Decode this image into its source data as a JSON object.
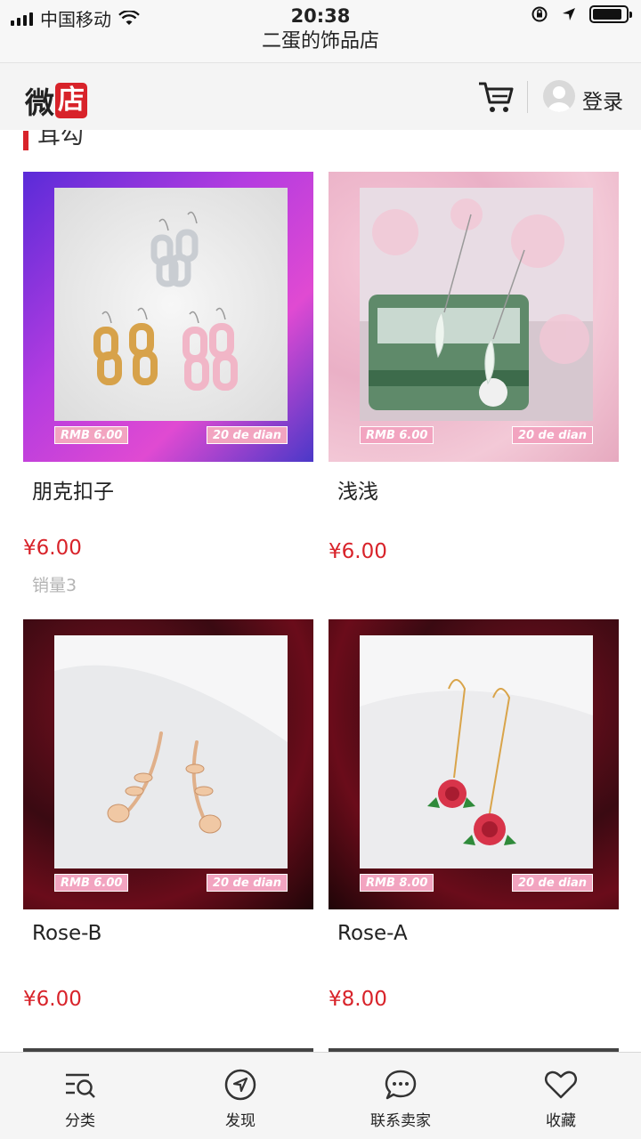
{
  "status_bar": {
    "carrier": "中国移动",
    "time": "20:38"
  },
  "shop_name": "二蛋的饰品店",
  "header": {
    "logo_text": "微",
    "logo_badge": "店",
    "login_label": "登录"
  },
  "section": {
    "title": "耳勾"
  },
  "products": [
    {
      "name": "朋克扣子",
      "price": "¥6.00",
      "sales": "销量3",
      "price_tag": "RMB 6.00",
      "shop_tag": "20 de dian"
    },
    {
      "name": "浅浅",
      "price": "¥6.00",
      "sales": "",
      "price_tag": "RMB 6.00",
      "shop_tag": "20 de dian"
    },
    {
      "name": "Rose-B",
      "price": "¥6.00",
      "sales": "",
      "price_tag": "RMB 6.00",
      "shop_tag": "20 de dian"
    },
    {
      "name": "Rose-A",
      "price": "¥8.00",
      "sales": "",
      "price_tag": "RMB 8.00",
      "shop_tag": "20 de dian"
    }
  ],
  "tabbar": {
    "items": [
      {
        "label": "分类",
        "icon": "category-search-icon"
      },
      {
        "label": "发现",
        "icon": "compass-icon"
      },
      {
        "label": "联系卖家",
        "icon": "chat-bubble-icon"
      },
      {
        "label": "收藏",
        "icon": "heart-icon"
      }
    ]
  },
  "colors": {
    "accent": "#d8232a",
    "tag_pink": "#f2a4c0"
  }
}
